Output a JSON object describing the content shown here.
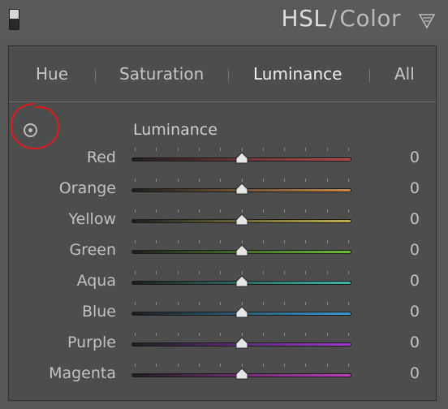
{
  "panel": {
    "title_main": "HSL",
    "title_sep": "/",
    "title_sub": "Color"
  },
  "tabs": [
    {
      "label": "Hue"
    },
    {
      "label": "Saturation"
    },
    {
      "label": "Luminance"
    },
    {
      "label": "All"
    }
  ],
  "section_label": "Luminance",
  "rows": [
    {
      "label": "Red",
      "value": "0",
      "color": "#b84b4b"
    },
    {
      "label": "Orange",
      "value": "0",
      "color": "#c98a4a"
    },
    {
      "label": "Yellow",
      "value": "0",
      "color": "#c2b24a"
    },
    {
      "label": "Green",
      "value": "0",
      "color": "#6fbf3a"
    },
    {
      "label": "Aqua",
      "value": "0",
      "color": "#3fb8a8"
    },
    {
      "label": "Blue",
      "value": "0",
      "color": "#3a9ad2"
    },
    {
      "label": "Purple",
      "value": "0",
      "color": "#a03ad2"
    },
    {
      "label": "Magenta",
      "value": "0",
      "color": "#c43ac4"
    }
  ],
  "slider_fraction": 0.5,
  "colors": {
    "annotation": "#d42020"
  }
}
